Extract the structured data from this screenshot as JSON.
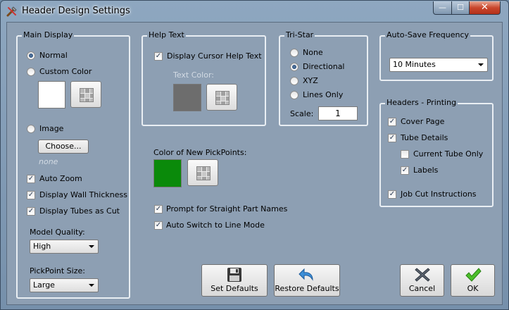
{
  "window": {
    "title": "Header Design Settings",
    "controls": {
      "minimize": "—",
      "maximize": "☐",
      "close": "✕"
    }
  },
  "main_display": {
    "title": "Main Display",
    "normal": "Normal",
    "custom_color": "Custom Color",
    "custom_color_value": "#ffffff",
    "image": "Image",
    "choose": "Choose...",
    "image_name": "none",
    "auto_zoom": "Auto Zoom",
    "display_wall_thickness": "Display Wall Thickness",
    "display_tubes_as_cut": "Display Tubes as Cut",
    "model_quality_label": "Model Quality:",
    "model_quality_value": "High",
    "pickpoint_size_label": "PickPoint Size:",
    "pickpoint_size_value": "Large"
  },
  "help_text": {
    "title": "Help Text",
    "display_cursor_help": "Display Cursor Help Text",
    "text_color_label": "Text Color:",
    "text_color_value": "#6d6d6d"
  },
  "tristar": {
    "title": "Tri-Star",
    "none": "None",
    "directional": "Directional",
    "xyz": "XYZ",
    "lines_only": "Lines Only",
    "scale_label": "Scale:",
    "scale_value": "1"
  },
  "autosave": {
    "title": "Auto-Save Frequency",
    "value": "10 Minutes"
  },
  "headers_printing": {
    "title": "Headers - Printing",
    "cover_page": "Cover Page",
    "tube_details": "Tube Details",
    "current_tube_only": "Current Tube Only",
    "labels": "Labels",
    "job_cut_instructions": "Job Cut Instructions"
  },
  "pickpoints": {
    "label": "Color of New PickPoints:",
    "color_value": "#0a8a0a"
  },
  "options": {
    "prompt_straight": "Prompt for Straight Part Names",
    "auto_switch": "Auto Switch to Line Mode"
  },
  "buttons": {
    "set_defaults": "Set Defaults",
    "restore_defaults": "Restore Defaults",
    "cancel": "Cancel",
    "ok": "OK"
  },
  "check_glyph": "✓"
}
